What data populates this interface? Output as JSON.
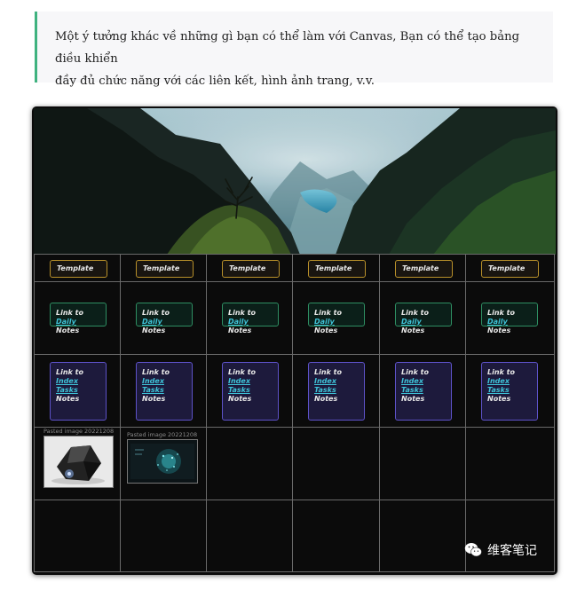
{
  "article": {
    "quote_line1": "Một ý tưởng khác về những gì bạn có thể làm với Canvas, Bạn có thể tạo bảng điều khiển",
    "quote_line2": "đầy đủ chức năng với các liên kết, hình ảnh trang, v.v.",
    "accent_color": "#3fb27f"
  },
  "canvas": {
    "banner_icon": "mountain-valley-landscape",
    "columns": [
      {
        "template": "Template",
        "daily": {
          "line1": "Link to",
          "link": "Daily",
          "suffix": " Notes"
        },
        "index": {
          "line1": "Link to",
          "link": "Index Tasks",
          "line3": "Notes"
        }
      },
      {
        "template": "Template",
        "daily": {
          "line1": "Link to",
          "link": "Daily",
          "suffix": " Notes"
        },
        "index": {
          "line1": "Link to",
          "link": "Index Tasks",
          "line3": "Notes"
        }
      },
      {
        "template": "Template",
        "daily": {
          "line1": "Link to",
          "link": "Daily",
          "suffix": " Notes"
        },
        "index": {
          "line1": "Link to",
          "link": "Index Tasks",
          "line3": "Notes"
        }
      },
      {
        "template": "Template",
        "daily": {
          "line1": "Link to",
          "link": "Daily",
          "suffix": " Notes"
        },
        "index": {
          "line1": "Link to",
          "link": "Index Tasks",
          "line3": "Notes"
        }
      },
      {
        "template": "Template",
        "daily": {
          "line1": "Link to",
          "link": "Daily",
          "suffix": " Notes"
        },
        "index": {
          "line1": "Link to",
          "link": "Index Tasks",
          "line3": "Notes"
        }
      },
      {
        "template": "Template",
        "daily": {
          "line1": "Link to",
          "link": "Daily",
          "suffix": " Notes"
        },
        "index": {
          "line1": "Link to",
          "link": "Index Tasks",
          "line3": "Notes"
        }
      }
    ],
    "pasted": [
      {
        "label": "Pasted image 20221208",
        "icon": "dark-crystal-object-image"
      },
      {
        "label": "Pasted image 20221208",
        "icon": "teal-particle-orb-image"
      }
    ],
    "colors": {
      "template_border": "#b8902a",
      "daily_border": "#2e8e62",
      "index_border": "#5d52c8",
      "link": "#3fc3d8"
    }
  },
  "watermark": {
    "icon": "wechat-icon",
    "text": "维客笔记"
  }
}
